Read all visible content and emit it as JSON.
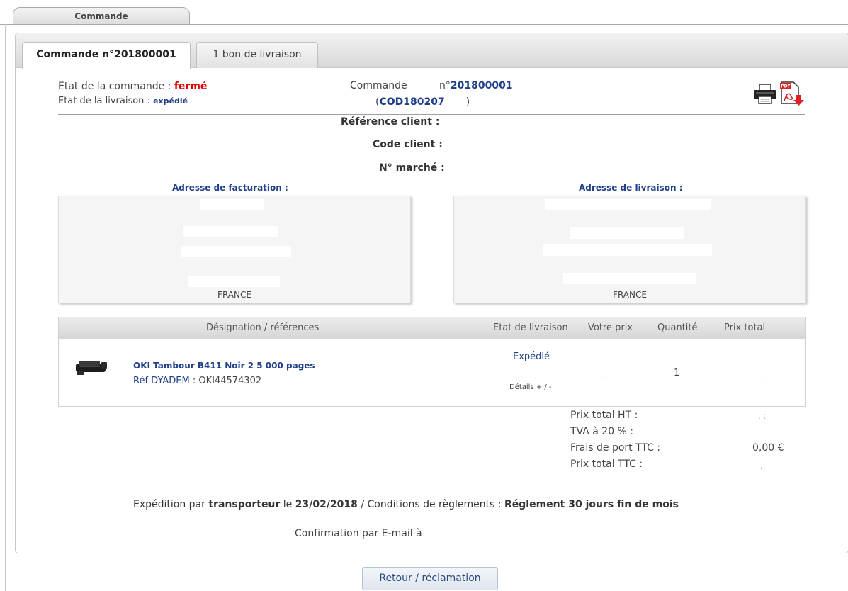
{
  "top_tab": "Commande",
  "tabs": [
    {
      "label": "Commande n°201800001"
    },
    {
      "label": "1 bon de livraison"
    }
  ],
  "order_state": {
    "label": "Etat de la commande :",
    "value": "fermé"
  },
  "delivery_state": {
    "label": "Etat de la livraison :",
    "value": "expédié"
  },
  "order": {
    "label": "Commande",
    "number_prefix": "n°",
    "number": "201800001",
    "code_open": "(",
    "code": "COD180207",
    "code_close": ")"
  },
  "icons": {
    "print": "printer-icon",
    "pdf": "pdf-download-icon"
  },
  "client": {
    "reference_label": "Référence client :",
    "code_label": "Code client :",
    "market_label": "N° marché :"
  },
  "billing": {
    "title": "Adresse de facturation :",
    "country": "FRANCE"
  },
  "shipping": {
    "title": "Adresse de livraison :",
    "country": "FRANCE"
  },
  "table": {
    "headers": [
      "Désignation / références",
      "Etat de livraison",
      "Votre prix",
      "Quantité",
      "Prix total"
    ],
    "rows": [
      {
        "product": "OKI Tambour B411 Noir 2 5 000 pages",
        "ref_label": "Réf DYADEM",
        "ref_sep": " : ",
        "ref_value": "OKI44574302",
        "status": "Expédié",
        "details": "Détails + / -",
        "price": ".",
        "quantity": "1",
        "total": "."
      }
    ]
  },
  "totals": {
    "ht_label": "Prix total HT :",
    "ht_value": ",    :",
    "tva_label": "TVA à 20 % :",
    "shipping_label": "Frais de port TTC :",
    "shipping_value": "0,00 €",
    "ttc_label": "Prix total TTC :",
    "ttc_value": "---,-- -"
  },
  "shipping_info": {
    "prefix": "Expédition par",
    "carrier": "transporteur",
    "le": "le",
    "date": "23/02/2018",
    "sep": "/ Conditions de règlements :",
    "terms": "Réglement 30 jours fin de mois"
  },
  "confirmation": "Confirmation par E-mail à",
  "return_button": "Retour / réclamation"
}
